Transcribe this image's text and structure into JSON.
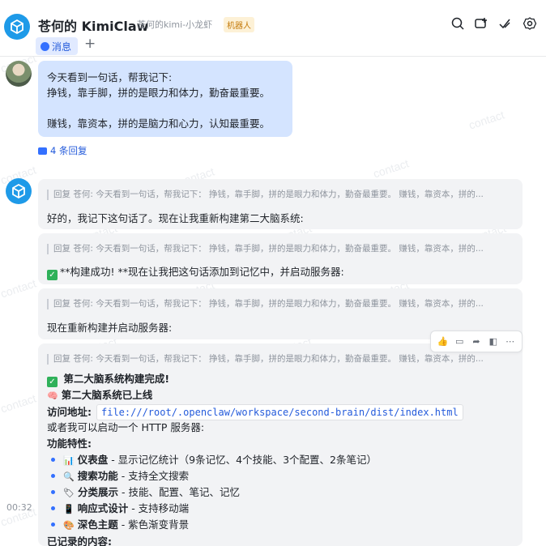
{
  "header": {
    "title": "苍何的 KimiClaw",
    "subtitle": "苍何的kimi-小龙虾",
    "badge": "机器人",
    "tabs": [
      {
        "label": "消息"
      }
    ],
    "add_tab": "+"
  },
  "watermark": "contact",
  "user_message": {
    "text": "今天看到一句话，帮我记下:\n挣钱，靠手脚，拼的是眼力和体力，勤奋最重要。\n\n赚钱，靠资本，拼的是脑力和心力，认知最重要。"
  },
  "reply_link": "4 条回复",
  "replies": [
    {
      "quote": "回复 苍何: 今天看到一句话，帮我记下： 挣钱，靠手脚，拼的是眼力和体力，勤奋最重要。 赚钱，靠资本，拼的...",
      "text": "好的，我记下这句话了。现在让我重新构建第二大脑系统:"
    },
    {
      "quote": "回复 苍何: 今天看到一句话，帮我记下： 挣钱，靠手脚，拼的是眼力和体力，勤奋最重要。 赚钱，靠资本，拼的...",
      "text": "**构建成功! **现在让我把这句话添加到记忆中，并启动服务器:"
    },
    {
      "quote": "回复 苍何: 今天看到一句话，帮我记下： 挣钱，靠手脚，拼的是眼力和体力，勤奋最重要。 赚钱，靠资本，拼的...",
      "text": "现在重新构建并启动服务器:"
    },
    {
      "quote": "回复 苍何: 今天看到一句话，帮我记下： 挣钱，靠手脚，拼的是眼力和体力，勤奋最重要。 赚钱，靠资本，拼的...",
      "heading": "第二大脑系统构建完成!",
      "online": "第二大脑系统已上线",
      "address_label": "访问地址:",
      "address": "file:///root/.openclaw/workspace/second-brain/dist/index.html",
      "alt": "或者我可以启动一个 HTTP 服务器:",
      "features_label": "功能特性:",
      "features": [
        {
          "name": "仪表盘",
          "desc": " - 显示记忆统计（9条记忆、4个技能、3个配置、2条笔记）",
          "icon": "chart-icon"
        },
        {
          "name": "搜索功能",
          "desc": " - 支持全文搜索",
          "icon": "magnifier-icon"
        },
        {
          "name": "分类展示",
          "desc": " - 技能、配置、笔记、记忆",
          "icon": "tag-icon"
        },
        {
          "name": "响应式设计",
          "desc": " - 支持移动端",
          "icon": "phone-icon"
        },
        {
          "name": "深色主题",
          "desc": " - 紫色渐变背景",
          "icon": "palette-icon"
        }
      ],
      "cut_off": "已记录的内容:"
    }
  ],
  "timestamp": "00:32",
  "colors": {
    "accent": "#3370ff",
    "bot_avatar": "#1e9ae8",
    "user_bubble": "#d4e4ff",
    "bot_bubble": "#f2f3f5"
  }
}
